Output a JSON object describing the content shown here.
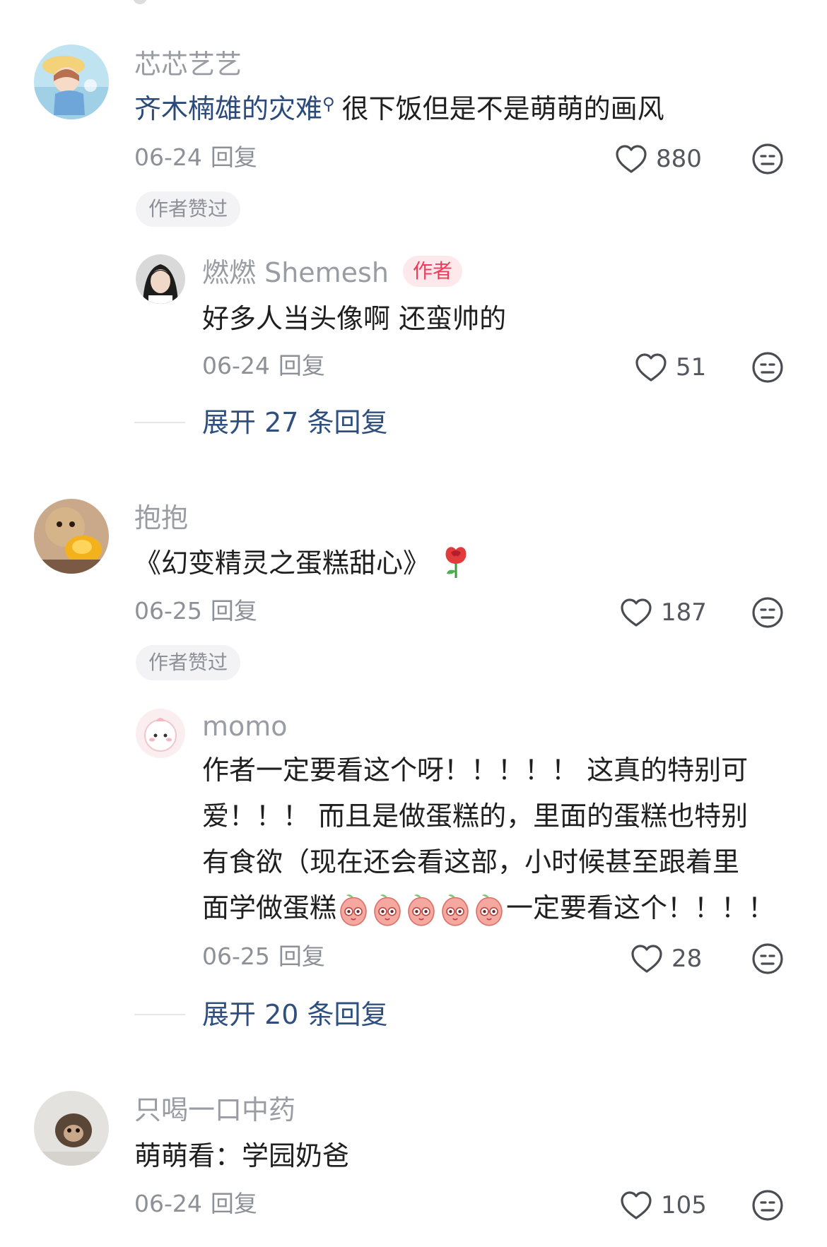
{
  "comments": [
    {
      "user": "芯芯艺艺",
      "text_link": "齐木楠雄的灾难",
      "text_rest": "很下饭但是不是萌萌的画风",
      "date": "06-24",
      "reply_label": "回复",
      "likes": "880",
      "chip": "作者赞过",
      "sub_reply": {
        "user": "燃燃 Shemesh",
        "badge": "作者",
        "text": "好多人当头像啊 还蛮帅的",
        "date": "06-24",
        "reply_label": "回复",
        "likes": "51"
      },
      "expand": "展开 27 条回复"
    },
    {
      "user": "抱抱",
      "text": "《幻变精灵之蛋糕甜心》",
      "date": "06-25",
      "reply_label": "回复",
      "likes": "187",
      "chip": "作者赞过",
      "sub_reply": {
        "user": "momo",
        "lines": [
          "作者一定要看这个呀！！！！！ 这真的特别可",
          "爱！！！ 而且是做蛋糕的，里面的蛋糕也特别",
          "有食欲（现在还会看这部，小时候甚至跟着里",
          "面学做蛋糕"
        ],
        "line4_tail": "一定要看这个！！！！",
        "date": "06-25",
        "reply_label": "回复",
        "likes": "28"
      },
      "expand": "展开 20 条回复"
    },
    {
      "user": "只喝一口中药",
      "text": "萌萌看：学园奶爸",
      "date": "06-24",
      "reply_label": "回复",
      "likes": "105"
    }
  ],
  "colors": {
    "accent_link": "#2b4a7a",
    "author_badge": "#ee3c5b",
    "muted": "#8e9097"
  },
  "icons": [
    "heart-outline-icon",
    "meh-face-icon",
    "search-icon",
    "rose-emoji",
    "peach-face-emoji"
  ]
}
